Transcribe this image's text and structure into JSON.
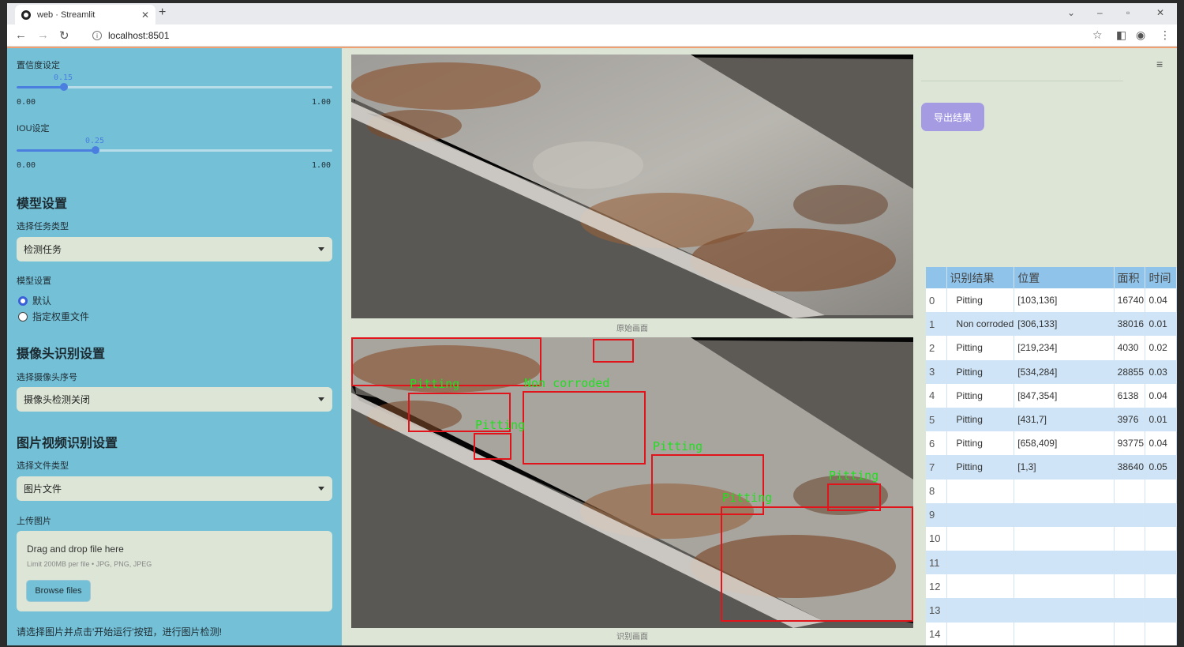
{
  "browser": {
    "tab_title": "web · Streamlit",
    "url": "localhost:8501"
  },
  "sidebar": {
    "confidence_label": "置信度设定",
    "confidence_value": "0.15",
    "confidence": 0.15,
    "iou_label": "IOU设定",
    "iou_value": "0.25",
    "iou": 0.25,
    "slider_min": "0.00",
    "slider_max": "1.00",
    "model_header": "模型设置",
    "task_type_label": "选择任务类型",
    "task_type_value": "检测任务",
    "model_label": "模型设置",
    "model_option_default": "默认",
    "model_option_custom": "指定权重文件",
    "camera_header": "摄像头识别设置",
    "camera_label": "选择摄像头序号",
    "camera_value": "摄像头检测关闭",
    "media_header": "图片视频识别设置",
    "file_type_label": "选择文件类型",
    "file_type_value": "图片文件",
    "upload_label": "上传图片",
    "upload_drag": "Drag and drop file here",
    "upload_limit": "Limit 200MB per file • JPG, PNG, JPEG",
    "upload_button": "Browse files",
    "hint": "请选择图片并点击'开始运行'按钮，进行图片检测!"
  },
  "images": {
    "original_caption": "原始画面",
    "detected_caption": "识别画面"
  },
  "detections": [
    {
      "label": "Pitting",
      "show": false
    },
    {
      "label": "Pitting",
      "show": true
    },
    {
      "label": "Non corroded",
      "show": true
    },
    {
      "label": "Pitting",
      "show": true
    },
    {
      "label": "Pitting",
      "show": true
    },
    {
      "label": "Pitting",
      "show": true
    },
    {
      "label": "Pitting",
      "show": true
    }
  ],
  "results": {
    "export_button": "导出结果",
    "columns": [
      "",
      "识别结果",
      "位置",
      "面积",
      "时间"
    ],
    "rows": [
      [
        "0",
        "Pitting",
        "[103,136]",
        "16740",
        "0.04"
      ],
      [
        "1",
        "Non corroded",
        "[306,133]",
        "38016",
        "0.01"
      ],
      [
        "2",
        "Pitting",
        "[219,234]",
        "4030",
        "0.02"
      ],
      [
        "3",
        "Pitting",
        "[534,284]",
        "28855",
        "0.03"
      ],
      [
        "4",
        "Pitting",
        "[847,354]",
        "6138",
        "0.04"
      ],
      [
        "5",
        "Pitting",
        "[431,7]",
        "3976",
        "0.01"
      ],
      [
        "6",
        "Pitting",
        "[658,409]",
        "93775",
        "0.04"
      ],
      [
        "7",
        "Pitting",
        "[1,3]",
        "38640",
        "0.05"
      ],
      [
        "8",
        "",
        "",
        "",
        ""
      ],
      [
        "9",
        "",
        "",
        "",
        ""
      ],
      [
        "10",
        "",
        "",
        "",
        ""
      ],
      [
        "11",
        "",
        "",
        "",
        ""
      ],
      [
        "12",
        "",
        "",
        "",
        ""
      ],
      [
        "13",
        "",
        "",
        "",
        ""
      ],
      [
        "14",
        "",
        "",
        "",
        ""
      ]
    ]
  }
}
